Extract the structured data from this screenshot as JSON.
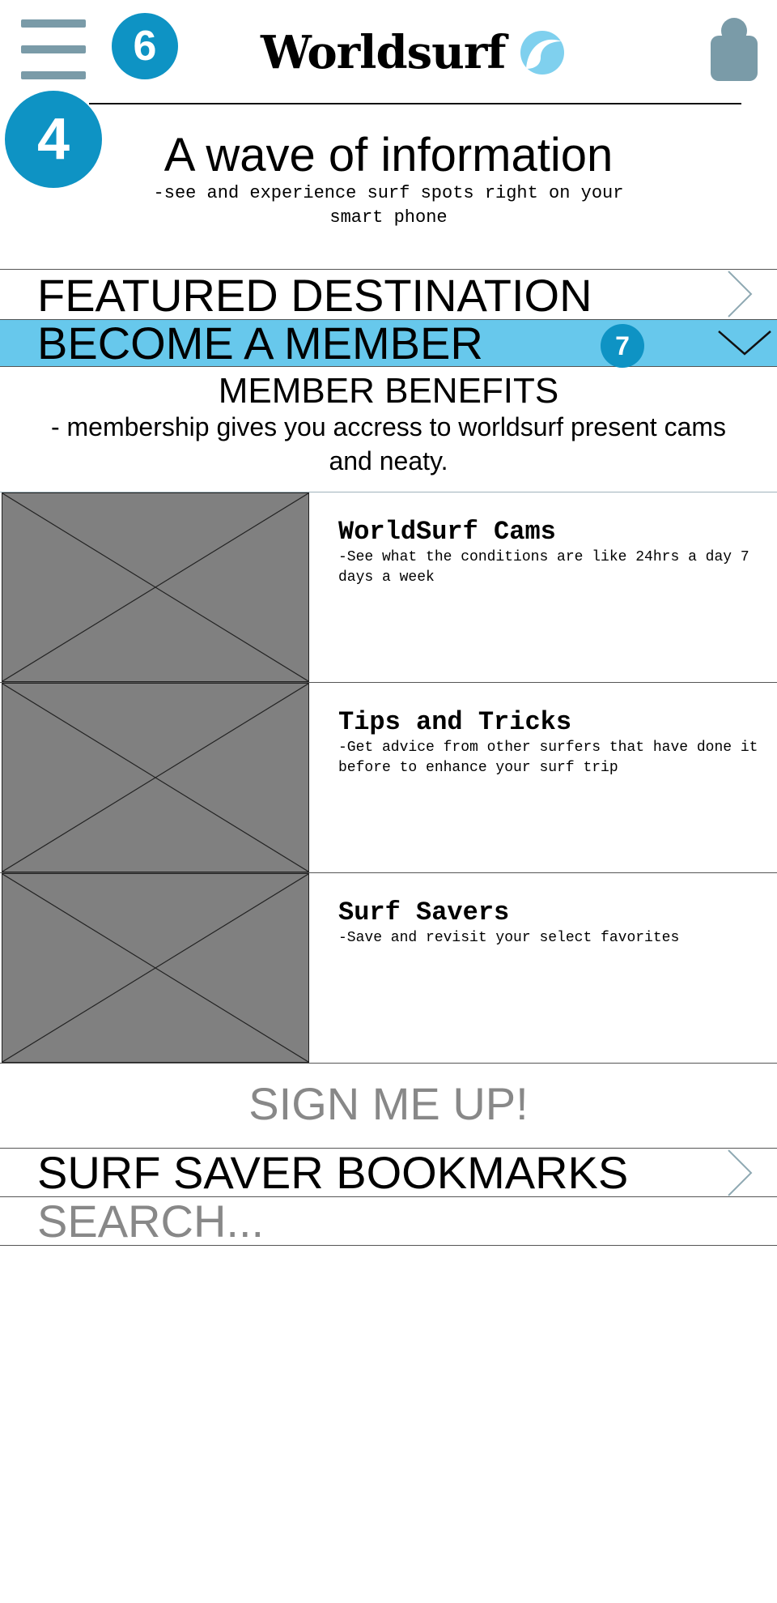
{
  "header": {
    "menu_badge": "6",
    "brand_name": "Worldsurf",
    "logo_icon": "wave-icon",
    "account_icon": "user-icon",
    "section_badge": "4"
  },
  "hero": {
    "headline": "A wave of information",
    "subline": "-see and experience surf spots right on your smart phone"
  },
  "nav": {
    "featured_label": "FEATURED DESTINATION",
    "member_label": "BECOME A MEMBER",
    "member_badge": "7"
  },
  "benefits": {
    "title": "MEMBER BENEFITS",
    "text": "- membership gives you accress to worldsurf present cams and neaty."
  },
  "features": [
    {
      "title": "WorldSurf Cams",
      "desc": "-See what the conditions are like 24hrs a day 7 days a week"
    },
    {
      "title": "Tips and Tricks",
      "desc": "-Get advice from other surfers that have done it before to enhance your surf trip"
    },
    {
      "title": "Surf Savers",
      "desc": "-Save and revisit your select favorites"
    }
  ],
  "signup_label": "SIGN ME UP!",
  "bookmarks_label": "SURF SAVER BOOKMARKS",
  "search_placeholder": "SEARCH...",
  "colors": {
    "accent": "#0e93c4",
    "member_bar": "#67c8ec",
    "icon_gray": "#7a9ba8",
    "placeholder_gray": "#808080"
  }
}
